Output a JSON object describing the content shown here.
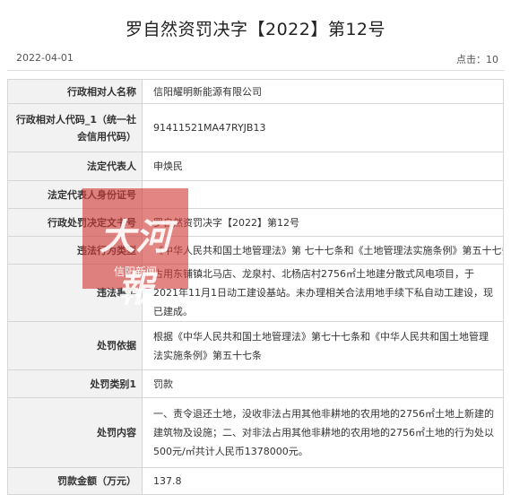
{
  "document": {
    "title": "罗自然资罚决字【2022】第12号",
    "date": "2022-04-01",
    "clicks": "点击：10"
  },
  "rows": [
    {
      "label": "行政相对人名称",
      "value": "信阳耀明新能源有限公司"
    },
    {
      "label": "行政相对人代码_1（统一社会信用代码）",
      "value": "91411521MA47RYJB13"
    },
    {
      "label": "法定代表人",
      "value": "申焕民"
    },
    {
      "label": "法定代表人身份证号",
      "value": ""
    },
    {
      "label": "行政处罚决定文书号",
      "value": "罗自然资罚决字【2022】第12号"
    },
    {
      "label": "违法行为类型",
      "value": "《中华人民共和国土地管理法》第 七十七条和《土地管理法实施条例》第五十七条"
    },
    {
      "label": "违法事实",
      "value": "占用东铺镇北马店、龙泉村、北杨店村2756㎡土地建分散式风电项目，于2021年11月1日动工建设基站。未办理相关合法用地手续下私自动工建设，现已建成。"
    },
    {
      "label": "处罚依据",
      "value": "根据《中华人民共和国土地管理法》第七十七条和《中华人民共和国土地管理法实施条例》第五十七条"
    },
    {
      "label": "处罚类别1",
      "value": "罚款"
    },
    {
      "label": "处罚内容",
      "value": "一、责令退还土地，没收非法占用其他非耕地的农用地的2756㎡土地上新建的建筑物及设施；二、对非法占用其他非耕地的农用地的2756㎡土地的行为处以500元/㎡共计人民币1378000元。"
    },
    {
      "label": "罚款金额（万元）",
      "value": "137.8"
    }
  ],
  "watermark": {
    "logo_text": "大河報",
    "subtitle": "信阳新闻"
  }
}
